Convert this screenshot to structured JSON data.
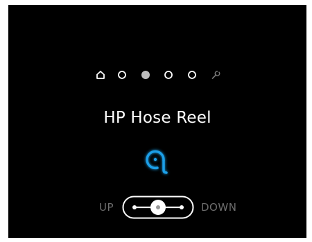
{
  "nav": {
    "items": [
      {
        "icon": "home-icon",
        "state": "inactive"
      },
      {
        "icon": "circle-icon",
        "state": "inactive"
      },
      {
        "icon": "circle-icon",
        "state": "active"
      },
      {
        "icon": "circle-icon",
        "state": "inactive"
      },
      {
        "icon": "circle-icon",
        "state": "inactive"
      },
      {
        "icon": "wrench-icon",
        "state": "inactive"
      }
    ]
  },
  "title": "HP Hose Reel",
  "reel": {
    "icon": "hose-reel-icon",
    "color": "#1a9fe8"
  },
  "toggle": {
    "left_label": "UP",
    "right_label": "DOWN",
    "position": "center"
  },
  "colors": {
    "background": "#000000",
    "foreground": "#ffffff",
    "muted": "#6e6e6e",
    "active_dot": "#bdbdbd",
    "accent": "#1a9fe8"
  }
}
